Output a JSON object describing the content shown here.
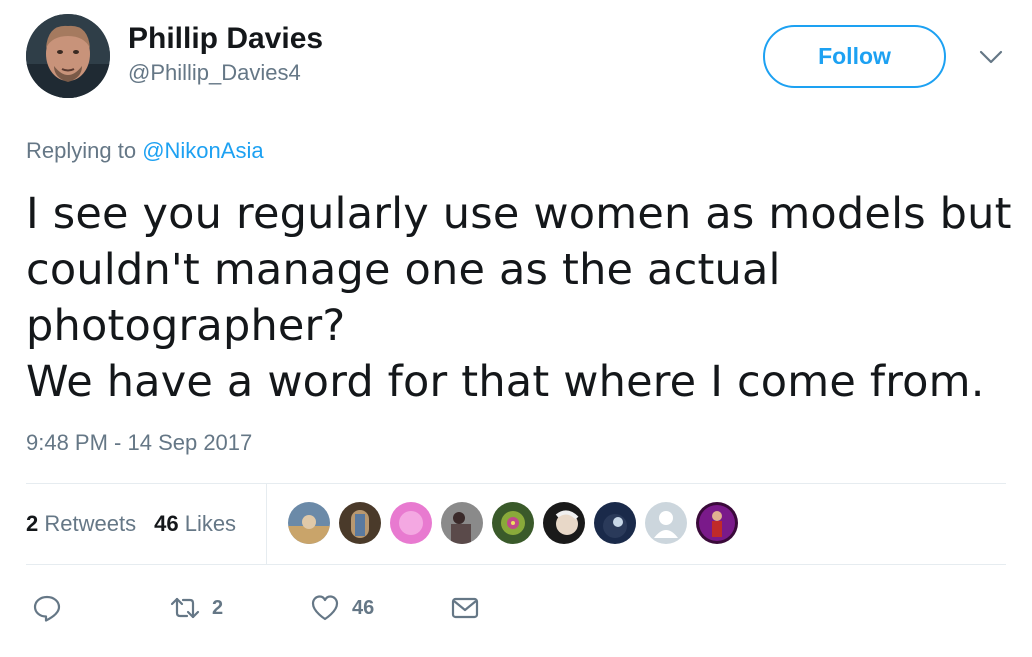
{
  "author": {
    "display_name": "Phillip Davies",
    "handle": "@Phillip_Davies4"
  },
  "follow_button": {
    "label": "Follow"
  },
  "replying": {
    "prefix": "Replying to",
    "mention": "@NikonAsia"
  },
  "tweet": {
    "lines": [
      "I see you regularly use women as models but",
      "couldn't manage one as the actual",
      "photographer?",
      "We have a word for that where I come from."
    ]
  },
  "timestamp": "9:48 PM - 14 Sep 2017",
  "stats": {
    "retweets_count": "2",
    "retweets_label": "Retweets",
    "likes_count": "46",
    "likes_label": "Likes"
  },
  "actions": {
    "retweet_count": "2",
    "like_count": "46"
  },
  "icons": [
    "chevron-down-icon",
    "reply-icon",
    "retweet-icon",
    "heart-icon",
    "message-icon"
  ],
  "colors": {
    "accent": "#1da1f2",
    "secondary_text": "#657786",
    "primary_text": "#14171a",
    "divider": "#e6ecf0"
  }
}
